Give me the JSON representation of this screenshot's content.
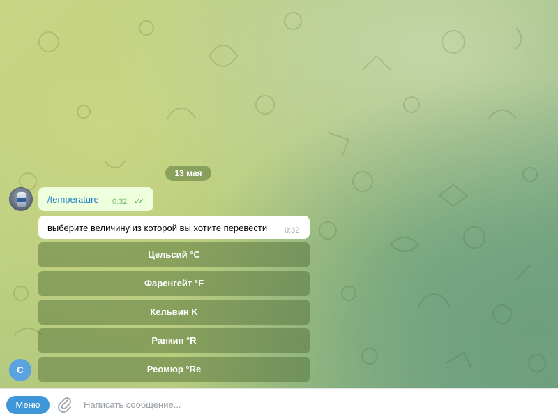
{
  "chat": {
    "date": "13 мая",
    "outgoing": {
      "text": "/temperature",
      "time": "0:32",
      "status_icon": "double-check-icon"
    },
    "incoming": {
      "text": "выберите величину из которой вы хотите перевести",
      "time": "0:32"
    },
    "keyboard": [
      {
        "label": "Цельсий °C"
      },
      {
        "label": "Фаренгейт °F"
      },
      {
        "label": "Кельвин K"
      },
      {
        "label": "Ранкин °R"
      },
      {
        "label": "Реомюр °Re"
      }
    ],
    "bot_avatar_letter": "C"
  },
  "composer": {
    "menu_label": "Меню",
    "placeholder": "Написать сообщение..."
  },
  "colors": {
    "accent": "#3f96d8",
    "outgoing_bubble": "#eeffde",
    "link": "#2a7fc9"
  }
}
